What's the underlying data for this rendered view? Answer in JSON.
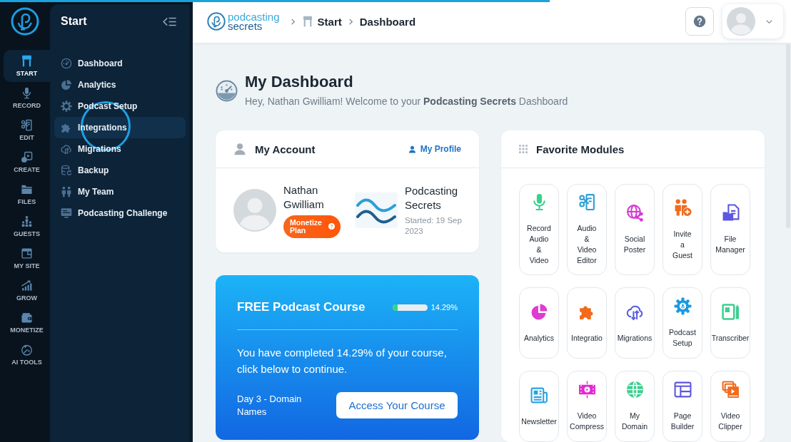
{
  "loading_bar": {
    "level": 0.695
  },
  "rail": {
    "items": [
      {
        "label": "START",
        "selected": true
      },
      {
        "label": "RECORD",
        "selected": false
      },
      {
        "label": "EDIT",
        "selected": false
      },
      {
        "label": "CREATE",
        "selected": false
      },
      {
        "label": "FILES",
        "selected": false
      },
      {
        "label": "GUESTS",
        "selected": false
      },
      {
        "label": "MY SITE",
        "selected": false
      },
      {
        "label": "GROW",
        "selected": false
      },
      {
        "label": "MONETIZE",
        "selected": false
      },
      {
        "label": "AI TOOLS",
        "selected": false
      }
    ]
  },
  "sidebar": {
    "title": "Start",
    "items": [
      {
        "label": "Dashboard",
        "hovered": false
      },
      {
        "label": "Analytics",
        "hovered": false
      },
      {
        "label": "Podcast Setup",
        "hovered": false
      },
      {
        "label": "Integrations",
        "hovered": true
      },
      {
        "label": "Migrations",
        "hovered": false
      },
      {
        "label": "Backup",
        "hovered": false
      },
      {
        "label": "My Team",
        "hovered": false
      },
      {
        "label": "Podcasting Challenge",
        "hovered": false
      }
    ]
  },
  "header": {
    "logo": {
      "words": [
        "podcasting",
        "secrets"
      ]
    },
    "breadcrumb": [
      "Start",
      "Dashboard"
    ]
  },
  "dashboard": {
    "title": "My Dashboard",
    "subtitle": "Hey, Nathan Gwilliam! Welcome to your **Podcasting Secrets** Dashboard"
  },
  "account_card": {
    "title": "My Account",
    "profile_link": "My Profile",
    "user": {
      "name": "Nathan Gwilliam",
      "plan": "Monetize Plan"
    },
    "podcast": {
      "name": "Podcasting Secrets",
      "started": "Started: 19 Sep 2023"
    }
  },
  "course_card": {
    "title": "FREE Podcast Course",
    "progress": {
      "level": 0.1429,
      "reading": "14.29%"
    },
    "message": "You have completed 14.29% of your course, click below to continue.",
    "lesson": "Day 3 - Domain Names",
    "button": "Access Your Course"
  },
  "modules_card": {
    "title": "Favorite Modules",
    "modules": [
      "Record Audio & Video",
      "Audio & Video Editor",
      "Social Poster",
      "Invite a Guest",
      "File Manager",
      "Analytics",
      "Integratio",
      "Migrations",
      "Podcast Setup",
      "Transcriber",
      "Newsletter",
      "Video Compress",
      "My Domain",
      "Page Builder",
      "Video Clipper"
    ]
  }
}
